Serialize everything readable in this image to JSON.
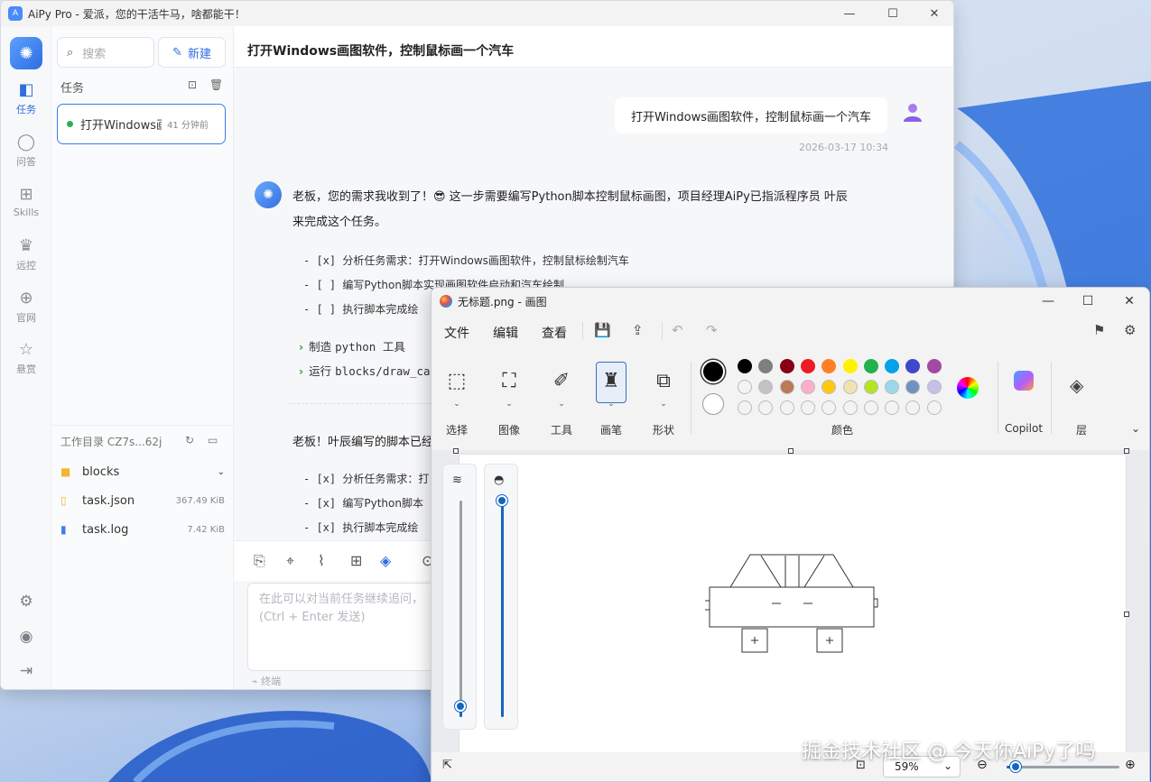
{
  "aipy": {
    "title": "AiPy Pro - 爱派，您的干活牛马，啥都能干！",
    "rail": [
      {
        "label": "任务",
        "icon": "tasks-icon"
      },
      {
        "label": "问答",
        "icon": "chat-icon"
      },
      {
        "label": "Skills",
        "icon": "skills-icon"
      },
      {
        "label": "远控",
        "icon": "remote-icon"
      },
      {
        "label": "官网",
        "icon": "globe-icon"
      },
      {
        "label": "悬赏",
        "icon": "bounty-icon"
      }
    ],
    "search_placeholder": "搜索",
    "new_label": "新建",
    "tasks_header": "任务",
    "task": {
      "name": "打开Windows画图软件，控制鼠标画一个汽车",
      "time": "41 分钟前"
    },
    "workdir": "工作目录 CZ7s...62j",
    "files": [
      {
        "name": "blocks",
        "size": ""
      },
      {
        "name": "task.json",
        "size": "367.49 KiB"
      },
      {
        "name": "task.log",
        "size": "7.42 KiB"
      }
    ],
    "chat_title": "打开Windows画图软件，控制鼠标画一个汽车",
    "user_msg": "打开Windows画图软件，控制鼠标画一个汽车",
    "user_time": "2026-03-17 10:34",
    "bot_line1": "老板，您的需求我收到了！😎 这一步需要编写Python脚本控制鼠标画图，项目经理AiPy已指派程序员 叶辰",
    "bot_line2": "来完成这个任务。",
    "checklist": [
      {
        "box": "- [x]",
        "text": "分析任务需求：打开Windows画图软件，控制鼠标绘制汽车"
      },
      {
        "box": "- [ ]",
        "text": "编写Python脚本实现画图软件启动和汽车绘制"
      },
      {
        "box": "- [ ]",
        "text": "执行脚本完成绘"
      }
    ],
    "tools": [
      {
        "label": "制造",
        "mono": "python 工具"
      },
      {
        "label": "运行",
        "mono": "blocks/draw_ca"
      }
    ],
    "bot2": "老板！叶辰编写的脚本已经",
    "checklist2": [
      {
        "box": "- [x]",
        "text": "分析任务需求：打"
      },
      {
        "box": "- [x]",
        "text": "编写Python脚本"
      },
      {
        "box": "- [x]",
        "text": "执行脚本完成绘"
      }
    ],
    "input_placeholder": "在此可以对当前任务继续追问，",
    "input_hint": "(Ctrl + Enter 发送)",
    "stop_label": "终端"
  },
  "paint": {
    "title": "无标题.png - 画图",
    "menus": [
      "文件",
      "编辑",
      "查看"
    ],
    "groups": [
      "选择",
      "图像",
      "工具",
      "画笔",
      "形状",
      "颜色",
      "Copilot",
      "层"
    ],
    "palette_row1": [
      "#000000",
      "#7f7f7f",
      "#880015",
      "#ed1c24",
      "#ff7f27",
      "#fff200",
      "#22b14c",
      "#00a2e8",
      "#3f48cc",
      "#a349a4"
    ],
    "palette_row2": [
      "#ffffff",
      "#c3c3c3",
      "#b97a57",
      "#ffaec9",
      "#ffc90e",
      "#efe4b0",
      "#b5e61d",
      "#99d9ea",
      "#7092be",
      "#c8bfe7"
    ],
    "brush_size_level": 0.05,
    "opacity_level": 1.0,
    "zoom": "59%"
  },
  "watermark": "掘金技术社区 @ 今天你AiPy了吗"
}
